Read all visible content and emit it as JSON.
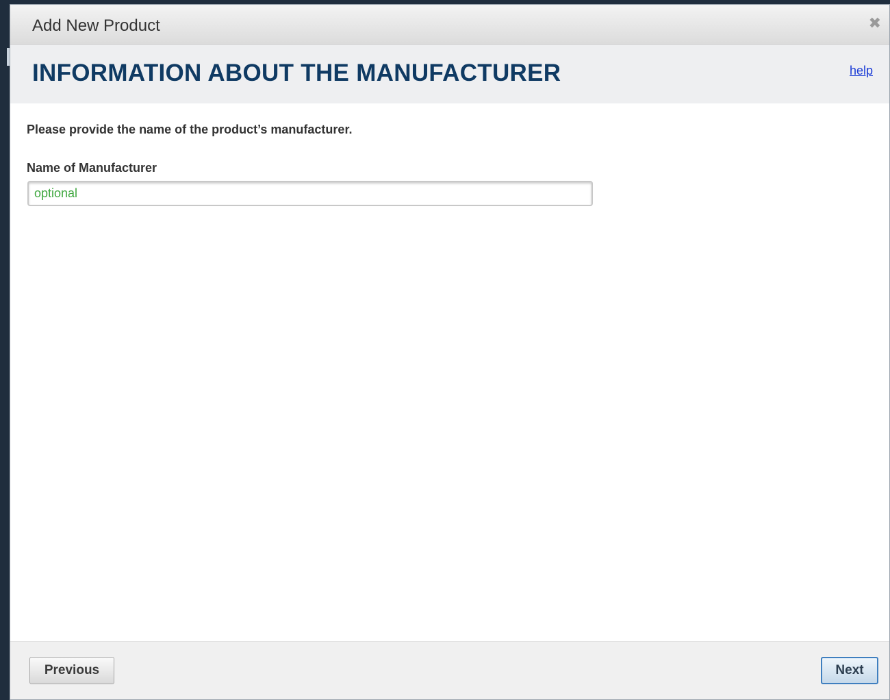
{
  "dialog": {
    "title": "Add New Product",
    "close_glyph": "✖",
    "close_icon": "close-icon"
  },
  "header": {
    "heading": "INFORMATION ABOUT THE MANUFACTURER",
    "help_link": "help"
  },
  "form": {
    "instructions": "Please provide the name of the product’s manufacturer.",
    "manufacturer_label": "Name of Manufacturer",
    "manufacturer_value": "",
    "manufacturer_placeholder": "optional"
  },
  "footer": {
    "previous_label": "Previous",
    "next_label": "Next"
  },
  "colors": {
    "heading": "#0f3a63",
    "link": "#1a3bd6",
    "placeholder": "#3fa73f",
    "next_border": "#3f7fbf"
  }
}
